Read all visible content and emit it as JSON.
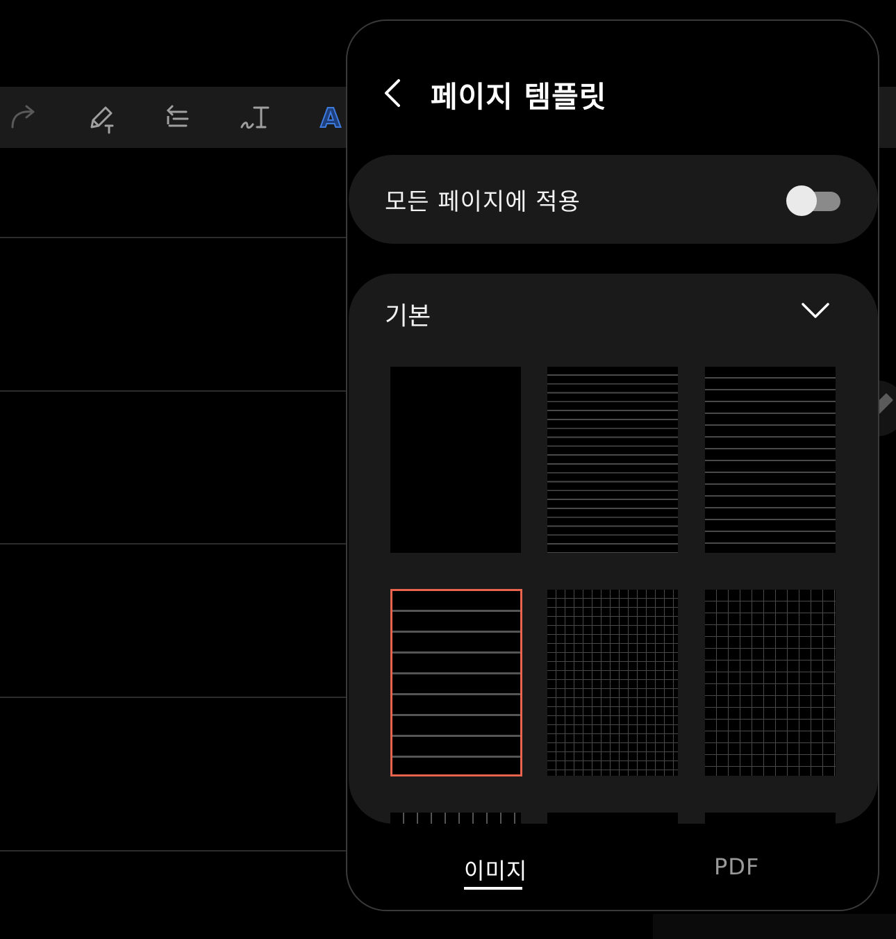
{
  "panel": {
    "title": "페이지 템플릿",
    "apply_all": {
      "label": "모든 페이지에 적용",
      "enabled": false
    },
    "section": {
      "label": "기본",
      "expanded": true,
      "templates": [
        {
          "name": "blank",
          "selected": false
        },
        {
          "name": "lined-dense",
          "selected": false
        },
        {
          "name": "lined-medium",
          "selected": false
        },
        {
          "name": "lined-wide",
          "selected": true
        },
        {
          "name": "grid-fine",
          "selected": false
        },
        {
          "name": "grid-medium",
          "selected": false
        }
      ]
    },
    "tabs": [
      {
        "label": "이미지",
        "active": true
      },
      {
        "label": "PDF",
        "active": false
      }
    ]
  },
  "colors": {
    "selection_border": "#e8644e",
    "accent_text_tool": "#3d7be0"
  },
  "toolbar_icons": [
    "redo-icon",
    "pen-settings-icon",
    "text-align-icon",
    "handwriting-to-text-icon",
    "text-style-icon"
  ],
  "edge_button_icon": "pencil-icon"
}
